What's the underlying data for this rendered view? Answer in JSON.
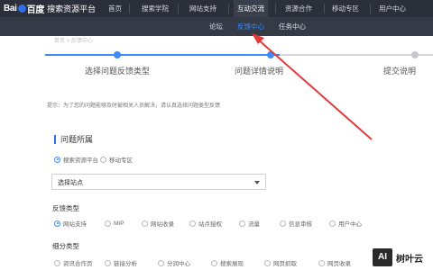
{
  "top_nav": {
    "logo": {
      "text_left": "Bai",
      "text_right": "百度",
      "paw_icon": "baidu-paw-icon"
    },
    "platform_title": "搜索资源平台",
    "items": [
      {
        "label": "首页"
      },
      {
        "label": "搜索学院"
      },
      {
        "label": "网站支持"
      },
      {
        "label": "互动交流"
      },
      {
        "label": "资源合作"
      },
      {
        "label": "移动专区"
      },
      {
        "label": "用户中心"
      }
    ],
    "active_index": 3
  },
  "sub_nav": {
    "items": [
      {
        "label": "论坛"
      },
      {
        "label": "反馈中心"
      },
      {
        "label": "任务中心"
      }
    ],
    "active_index": 1
  },
  "breadcrumb": "首页 > 反馈中心",
  "steps": [
    {
      "label": "选择问题反馈类型",
      "done": true
    },
    {
      "label": "问题详情说明",
      "done": true
    },
    {
      "label": "提交说明",
      "done": false
    }
  ],
  "hint": "提示：为了您的问题能够及时被相关人员解决，请认真选择问题类型反馈",
  "section": {
    "title": "问题所属"
  },
  "owner_options": [
    {
      "label": "搜索资源平台",
      "selected": true
    },
    {
      "label": "移动专区",
      "selected": false
    }
  ],
  "site_select": {
    "value": "选择站点"
  },
  "feedback_type": {
    "label": "反馈类型",
    "options": [
      {
        "label": "网站支持",
        "selected": true
      },
      {
        "label": "MIP",
        "selected": false
      },
      {
        "label": "网站收录",
        "selected": false
      },
      {
        "label": "站点授权",
        "selected": false
      },
      {
        "label": "流量",
        "selected": false
      },
      {
        "label": "信息审核",
        "selected": false
      },
      {
        "label": "用户中心",
        "selected": false
      }
    ]
  },
  "sub_type": {
    "label": "细分类型",
    "options": [
      {
        "label": "资讯合作页",
        "selected": false
      },
      {
        "label": "链接分析",
        "selected": false
      },
      {
        "label": "分润中心",
        "selected": false
      },
      {
        "label": "搜索展现",
        "selected": false
      },
      {
        "label": "网页抓取",
        "selected": false
      },
      {
        "label": "网页收录",
        "selected": false
      }
    ]
  },
  "watermark": {
    "box": "AI",
    "text": "树叶云"
  },
  "colors": {
    "accent": "#3d8cf5",
    "topbar": "#2b2f3a",
    "subbar": "#353a47",
    "annotation": "#e23a3a"
  }
}
